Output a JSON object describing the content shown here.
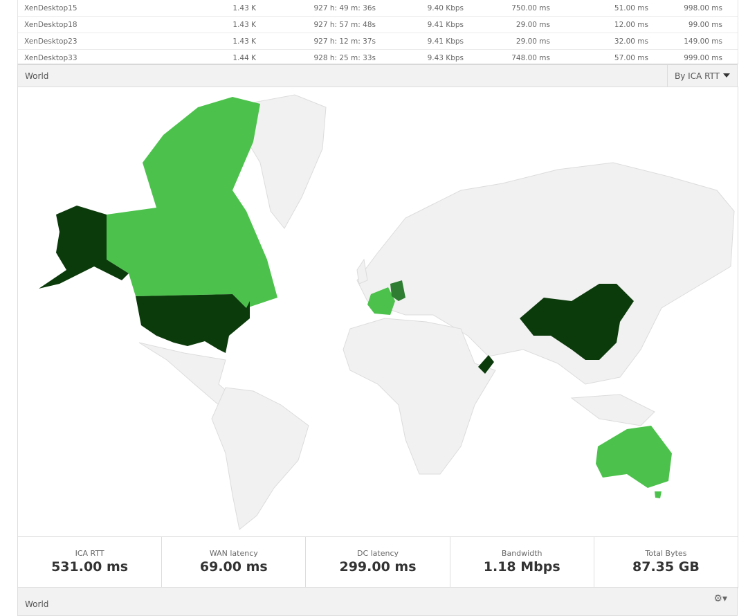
{
  "table": {
    "rows": [
      [
        "XenDesktop15",
        "1.43 K",
        "927 h: 49 m: 36s",
        "9.40 Kbps",
        "750.00 ms",
        "51.00 ms",
        "998.00 ms"
      ],
      [
        "XenDesktop18",
        "1.43 K",
        "927 h: 57 m: 48s",
        "9.41 Kbps",
        "29.00 ms",
        "12.00 ms",
        "99.00 ms"
      ],
      [
        "XenDesktop23",
        "1.43 K",
        "927 h: 12 m: 37s",
        "9.41 Kbps",
        "29.00 ms",
        "32.00 ms",
        "149.00 ms"
      ],
      [
        "XenDesktop33",
        "1.44 K",
        "928 h: 25 m: 33s",
        "9.43 Kbps",
        "748.00 ms",
        "57.00 ms",
        "999.00 ms"
      ]
    ]
  },
  "map_panel": {
    "title": "World",
    "dropdown": "By ICA RTT",
    "colors": {
      "high": "#0b3a0b",
      "medium": "#2e7d32",
      "low": "#4cc24c",
      "none": "#f1f1f1"
    },
    "highlighted": {
      "United States": "high",
      "Alaska": "high",
      "China": "high",
      "Oman": "high",
      "Canada": "low",
      "France": "low",
      "Australia": "low",
      "Germany": "medium"
    }
  },
  "stats": [
    {
      "label": "ICA RTT",
      "value": "531.00 ms"
    },
    {
      "label": "WAN latency",
      "value": "69.00 ms"
    },
    {
      "label": "DC latency",
      "value": "299.00 ms"
    },
    {
      "label": "Bandwidth",
      "value": "1.18 Mbps"
    },
    {
      "label": "Total Bytes",
      "value": "87.35 GB"
    }
  ],
  "bottom_panel": {
    "title": "World",
    "icon": "gear-icon"
  }
}
